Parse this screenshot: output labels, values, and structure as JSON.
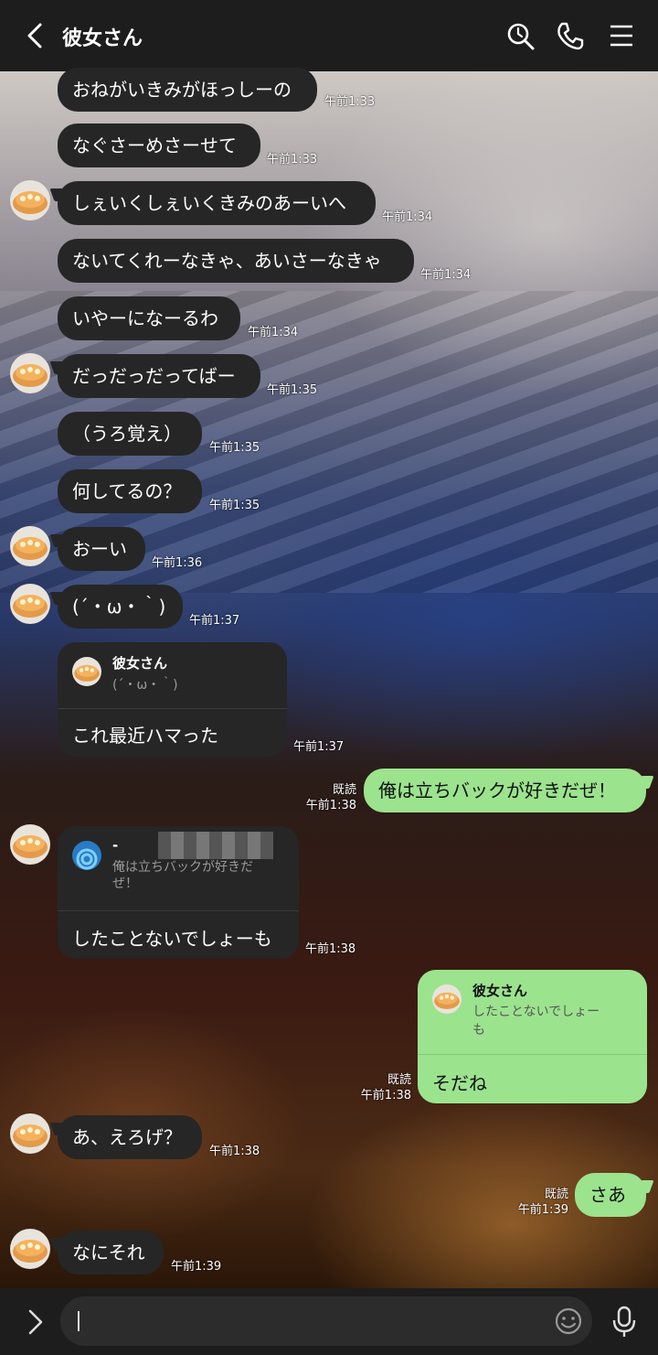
{
  "header": {
    "title": "彼女さん"
  },
  "messages": [
    {
      "text": "おねがいきみがほっしーの",
      "time": "午前1:33"
    },
    {
      "text": "なぐさーめさーせて",
      "time": "午前1:33"
    },
    {
      "text": "しぇいくしぇいくきみのあーいへ",
      "time": "午前1:34"
    },
    {
      "text": "ないてくれーなきゃ、あいさーなきゃ",
      "time": "午前1:34"
    },
    {
      "text": "いやーになーるわ",
      "time": "午前1:34"
    },
    {
      "text": "だっだっだってばー",
      "time": "午前1:35"
    },
    {
      "text": "（うろ覚え）",
      "time": "午前1:35"
    },
    {
      "text": "何してるの？",
      "time": "午前1:35"
    },
    {
      "text": "おーい",
      "time": "午前1:36"
    },
    {
      "text": "(´・ω・｀)",
      "time": "午前1:37"
    }
  ],
  "reply1": {
    "quote_name": "彼女さん",
    "quote_text": "(´・ω・｀)",
    "text": "これ最近ハマった",
    "time": "午前1:37"
  },
  "sent1": {
    "text": "俺は立ちバックが好きだぜ！",
    "read": "既読",
    "time": "午前1:38"
  },
  "reply2": {
    "quote_name": "-",
    "quote_text_line1": "俺は立ちバックが好きだ",
    "quote_text_line2": "ぜ！",
    "text": "したことないでしょーも",
    "time": "午前1:38"
  },
  "sent2": {
    "quote_name": "彼女さん",
    "quote_text_line1": "したことないでしょー",
    "quote_text_line2": "も",
    "text": "そだね",
    "read": "既読",
    "time": "午前1:38"
  },
  "msg_a": {
    "text": "あ、えろげ？",
    "time": "午前1:38"
  },
  "sent3": {
    "text": "さあ",
    "read": "既読",
    "time": "午前1:39"
  },
  "msg_b": {
    "text": "なにそれ",
    "time": "午前1:39"
  },
  "input": {
    "value": ""
  }
}
